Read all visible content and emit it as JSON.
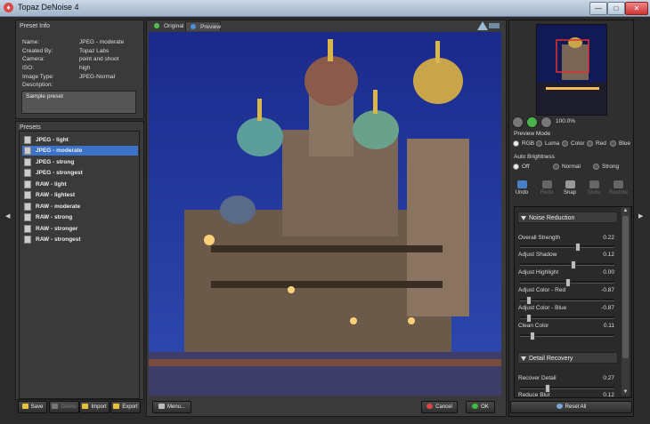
{
  "window": {
    "title": "Topaz DeNoise 4",
    "minimize": "—",
    "maximize": "□",
    "close": "✕"
  },
  "preset_info": {
    "header": "Preset Info",
    "rows": [
      {
        "label": "Name:",
        "value": "JPEG - moderate"
      },
      {
        "label": "Created By:",
        "value": "Topaz Labs"
      },
      {
        "label": "Camera:",
        "value": "point and shoot"
      },
      {
        "label": "ISO:",
        "value": "high"
      },
      {
        "label": "Image Type:",
        "value": "JPEG-Normal"
      },
      {
        "label": "Description:",
        "value": ""
      }
    ],
    "description": "Sample preset"
  },
  "presets": {
    "header": "Presets",
    "items": [
      "JPEG - light",
      "JPEG - moderate",
      "JPEG - strong",
      "JPEG - strongest",
      "RAW - light",
      "RAW - lightest",
      "RAW - moderate",
      "RAW - strong",
      "RAW - stronger",
      "RAW - strongest"
    ],
    "selected": "JPEG - moderate"
  },
  "preset_buttons": {
    "save": "Save",
    "delete": "Delete",
    "import": "Import",
    "export": "Export"
  },
  "tabs": {
    "original": "Original",
    "preview": "Preview"
  },
  "footer": {
    "menu": "Menu...",
    "cancel": "Cancel",
    "ok": "OK"
  },
  "navigator": {
    "zoom": "100.0%"
  },
  "preview_mode": {
    "label": "Preview Mode",
    "options": [
      "RGB",
      "Luma",
      "Color",
      "Red",
      "Blue"
    ],
    "selected": "RGB"
  },
  "auto_brightness": {
    "label": "Auto Brightness",
    "options": [
      "Off",
      "Normal",
      "Strong"
    ],
    "selected": "Off"
  },
  "tools": {
    "undo": "Undo",
    "redo": "Redo",
    "snap": "Snap",
    "store": "Store",
    "restore": "Restore"
  },
  "noise_reduction": {
    "title": "Noise Reduction",
    "sliders": [
      {
        "label": "Overall Strength",
        "value": "0.22",
        "pos": 0.61
      },
      {
        "label": "Adjust Shadow",
        "value": "0.12",
        "pos": 0.56
      },
      {
        "label": "Adjust Highlight",
        "value": "0.00",
        "pos": 0.5
      },
      {
        "label": "Adjust Color - Red",
        "value": "-0.87",
        "pos": 0.07
      },
      {
        "label": "Adjust Color - Blue",
        "value": "-0.87",
        "pos": 0.07
      },
      {
        "label": "Clean Color",
        "value": "0.11",
        "pos": 0.11
      }
    ]
  },
  "detail_recovery": {
    "title": "Detail Recovery",
    "sliders": [
      {
        "label": "Recover Detail",
        "value": "0.27",
        "pos": 0.27
      },
      {
        "label": "Reduce Blur",
        "value": "0.12",
        "pos": 0.12
      }
    ]
  },
  "reset_all": "Reset All"
}
